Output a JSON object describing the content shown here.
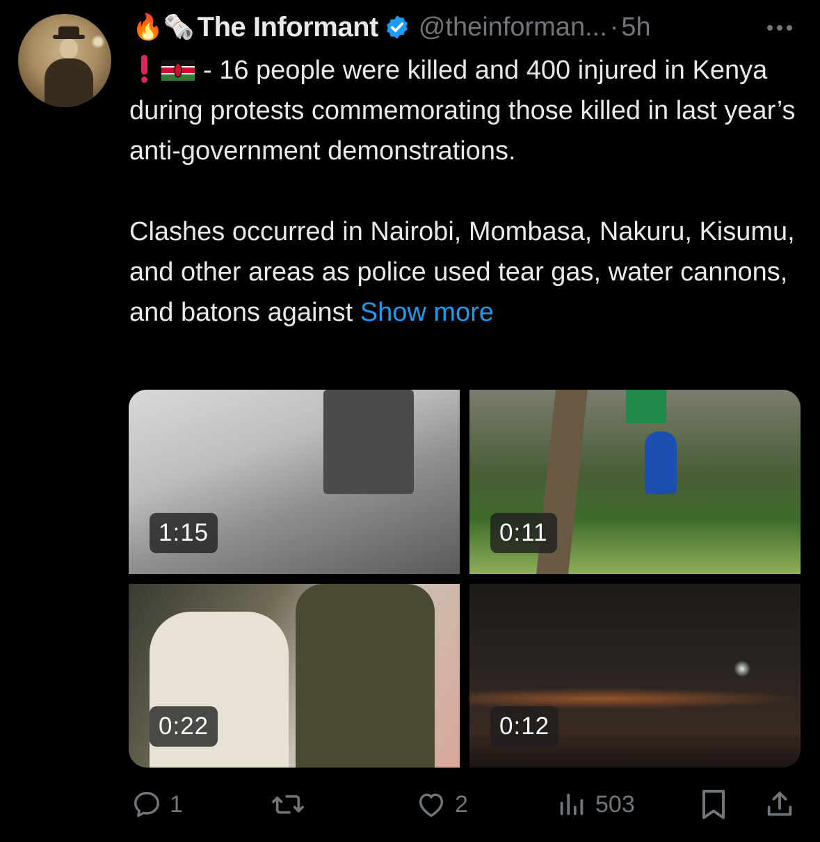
{
  "tweet": {
    "author_name": "The Informant",
    "handle": "@theinforman...",
    "separator": "·",
    "time": "5h",
    "prefix_emojis": [
      "🔥",
      "🗞️"
    ],
    "text_line1_suffix": "- 16 people were killed and 400 injured in",
    "text_para1_rest": "Kenya during protests commemorating those killed in last year’s anti-government demonstrations.",
    "text_para2": "Clashes occurred in Nairobi, Mombasa, Nakuru, Kisumu, and other areas as police used tear gas, water cannons, and batons against",
    "show_more": "Show more",
    "verified_color": "#1d9bf0",
    "link_color": "#1d9bf0"
  },
  "media": {
    "videos": [
      {
        "duration": "1:15"
      },
      {
        "duration": "0:11"
      },
      {
        "duration": "0:22"
      },
      {
        "duration": "0:12"
      }
    ]
  },
  "actions": {
    "replies": "1",
    "reposts": "",
    "likes": "2",
    "views": "503",
    "icons": [
      "reply-icon",
      "repost-icon",
      "like-icon",
      "views-icon",
      "bookmark-icon",
      "share-icon"
    ]
  }
}
